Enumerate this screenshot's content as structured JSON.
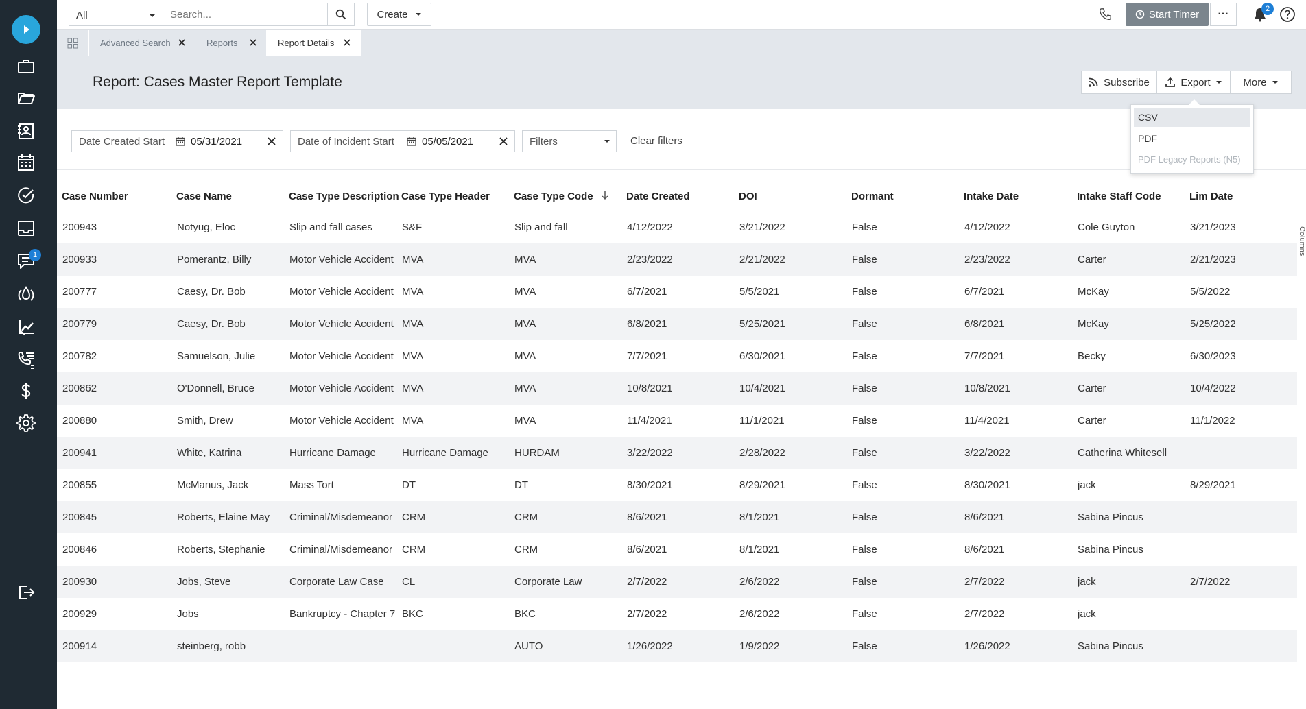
{
  "sidebar": {
    "items": [
      {
        "icon": "briefcase-icon"
      },
      {
        "icon": "folder-open-icon"
      },
      {
        "icon": "contact-card-icon"
      },
      {
        "icon": "calendar-icon"
      },
      {
        "icon": "check-circle-icon"
      },
      {
        "icon": "inbox-icon"
      },
      {
        "icon": "chat-icon",
        "badge": "1"
      },
      {
        "icon": "drop-icon"
      },
      {
        "icon": "chart-hand-icon"
      },
      {
        "icon": "phone-list-icon"
      },
      {
        "icon": "dollar-icon"
      },
      {
        "icon": "gear-icon"
      },
      {
        "icon": "logout-icon"
      }
    ]
  },
  "topbar": {
    "scope_value": "All",
    "search_placeholder": "Search...",
    "create_label": "Create",
    "timer_label": "Start Timer",
    "more_label": "···",
    "notif_count": "2"
  },
  "tabs": [
    {
      "label": "Advanced Search"
    },
    {
      "label": "Reports"
    },
    {
      "label": "Report Details"
    }
  ],
  "header": {
    "title": "Report: Cases Master Report Template",
    "subscribe_label": "Subscribe",
    "export_label": "Export",
    "more_label": "More"
  },
  "export_menu": [
    "CSV",
    "PDF",
    "PDF Legacy Reports (N5)"
  ],
  "filters": {
    "date_created_label": "Date Created Start",
    "date_created_value": "05/31/2021",
    "date_incident_label": "Date of Incident Start",
    "date_incident_value": "05/05/2021",
    "filters_label": "Filters",
    "clear_label": "Clear filters"
  },
  "table": {
    "columns": [
      "Case Number",
      "Case Name",
      "Case Type Description",
      "Case Type Header",
      "Case Type Code",
      "Date Created",
      "DOI",
      "Dormant",
      "Intake Date",
      "Intake Staff Code",
      "Lim Date"
    ],
    "sort_column": "Case Type Code",
    "rows": [
      [
        "200943",
        "Notyug, Eloc",
        "Slip and fall cases",
        "S&F",
        "Slip and fall",
        "4/12/2022",
        "3/21/2022",
        "False",
        "4/12/2022",
        "Cole Guyton",
        "3/21/2023"
      ],
      [
        "200933",
        "Pomerantz, Billy",
        "Motor Vehicle Accident",
        "MVA",
        "MVA",
        "2/23/2022",
        "2/21/2022",
        "False",
        "2/23/2022",
        "Carter",
        "2/21/2023"
      ],
      [
        "200777",
        "Caesy, Dr. Bob",
        "Motor Vehicle Accident",
        "MVA",
        "MVA",
        "6/7/2021",
        "5/5/2021",
        "False",
        "6/7/2021",
        "McKay",
        "5/5/2022"
      ],
      [
        "200779",
        "Caesy, Dr. Bob",
        "Motor Vehicle Accident",
        "MVA",
        "MVA",
        "6/8/2021",
        "5/25/2021",
        "False",
        "6/8/2021",
        "McKay",
        "5/25/2022"
      ],
      [
        "200782",
        "Samuelson, Julie",
        "Motor Vehicle Accident",
        "MVA",
        "MVA",
        "7/7/2021",
        "6/30/2021",
        "False",
        "7/7/2021",
        "Becky",
        "6/30/2023"
      ],
      [
        "200862",
        "O'Donnell, Bruce",
        "Motor Vehicle Accident",
        "MVA",
        "MVA",
        "10/8/2021",
        "10/4/2021",
        "False",
        "10/8/2021",
        "Carter",
        "10/4/2022"
      ],
      [
        "200880",
        "Smith, Drew",
        "Motor Vehicle Accident",
        "MVA",
        "MVA",
        "11/4/2021",
        "11/1/2021",
        "False",
        "11/4/2021",
        "Carter",
        "11/1/2022"
      ],
      [
        "200941",
        "White, Katrina",
        "Hurricane Damage",
        "Hurricane Damage",
        "HURDAM",
        "3/22/2022",
        "2/28/2022",
        "False",
        "3/22/2022",
        "Catherina Whitesell",
        ""
      ],
      [
        "200855",
        "McManus, Jack",
        "Mass Tort",
        "DT",
        "DT",
        "8/30/2021",
        "8/29/2021",
        "False",
        "8/30/2021",
        "jack",
        "8/29/2021"
      ],
      [
        "200845",
        "Roberts, Elaine May",
        "Criminal/Misdemeanor",
        "CRM",
        "CRM",
        "8/6/2021",
        "8/1/2021",
        "False",
        "8/6/2021",
        "Sabina Pincus",
        ""
      ],
      [
        "200846",
        "Roberts, Stephanie",
        "Criminal/Misdemeanor",
        "CRM",
        "CRM",
        "8/6/2021",
        "8/1/2021",
        "False",
        "8/6/2021",
        "Sabina Pincus",
        ""
      ],
      [
        "200930",
        "Jobs, Steve",
        "Corporate Law Case",
        "CL",
        "Corporate Law",
        "2/7/2022",
        "2/6/2022",
        "False",
        "2/7/2022",
        "jack",
        "2/7/2022"
      ],
      [
        "200929",
        "Jobs",
        "Bankruptcy - Chapter 7",
        "BKC",
        "BKC",
        "2/7/2022",
        "2/6/2022",
        "False",
        "2/7/2022",
        "jack",
        ""
      ],
      [
        "200914",
        "steinberg, robb",
        "",
        "",
        "AUTO",
        "1/26/2022",
        "1/9/2022",
        "False",
        "1/26/2022",
        "Sabina Pincus",
        ""
      ]
    ]
  },
  "columns_panel_label": "Columns"
}
